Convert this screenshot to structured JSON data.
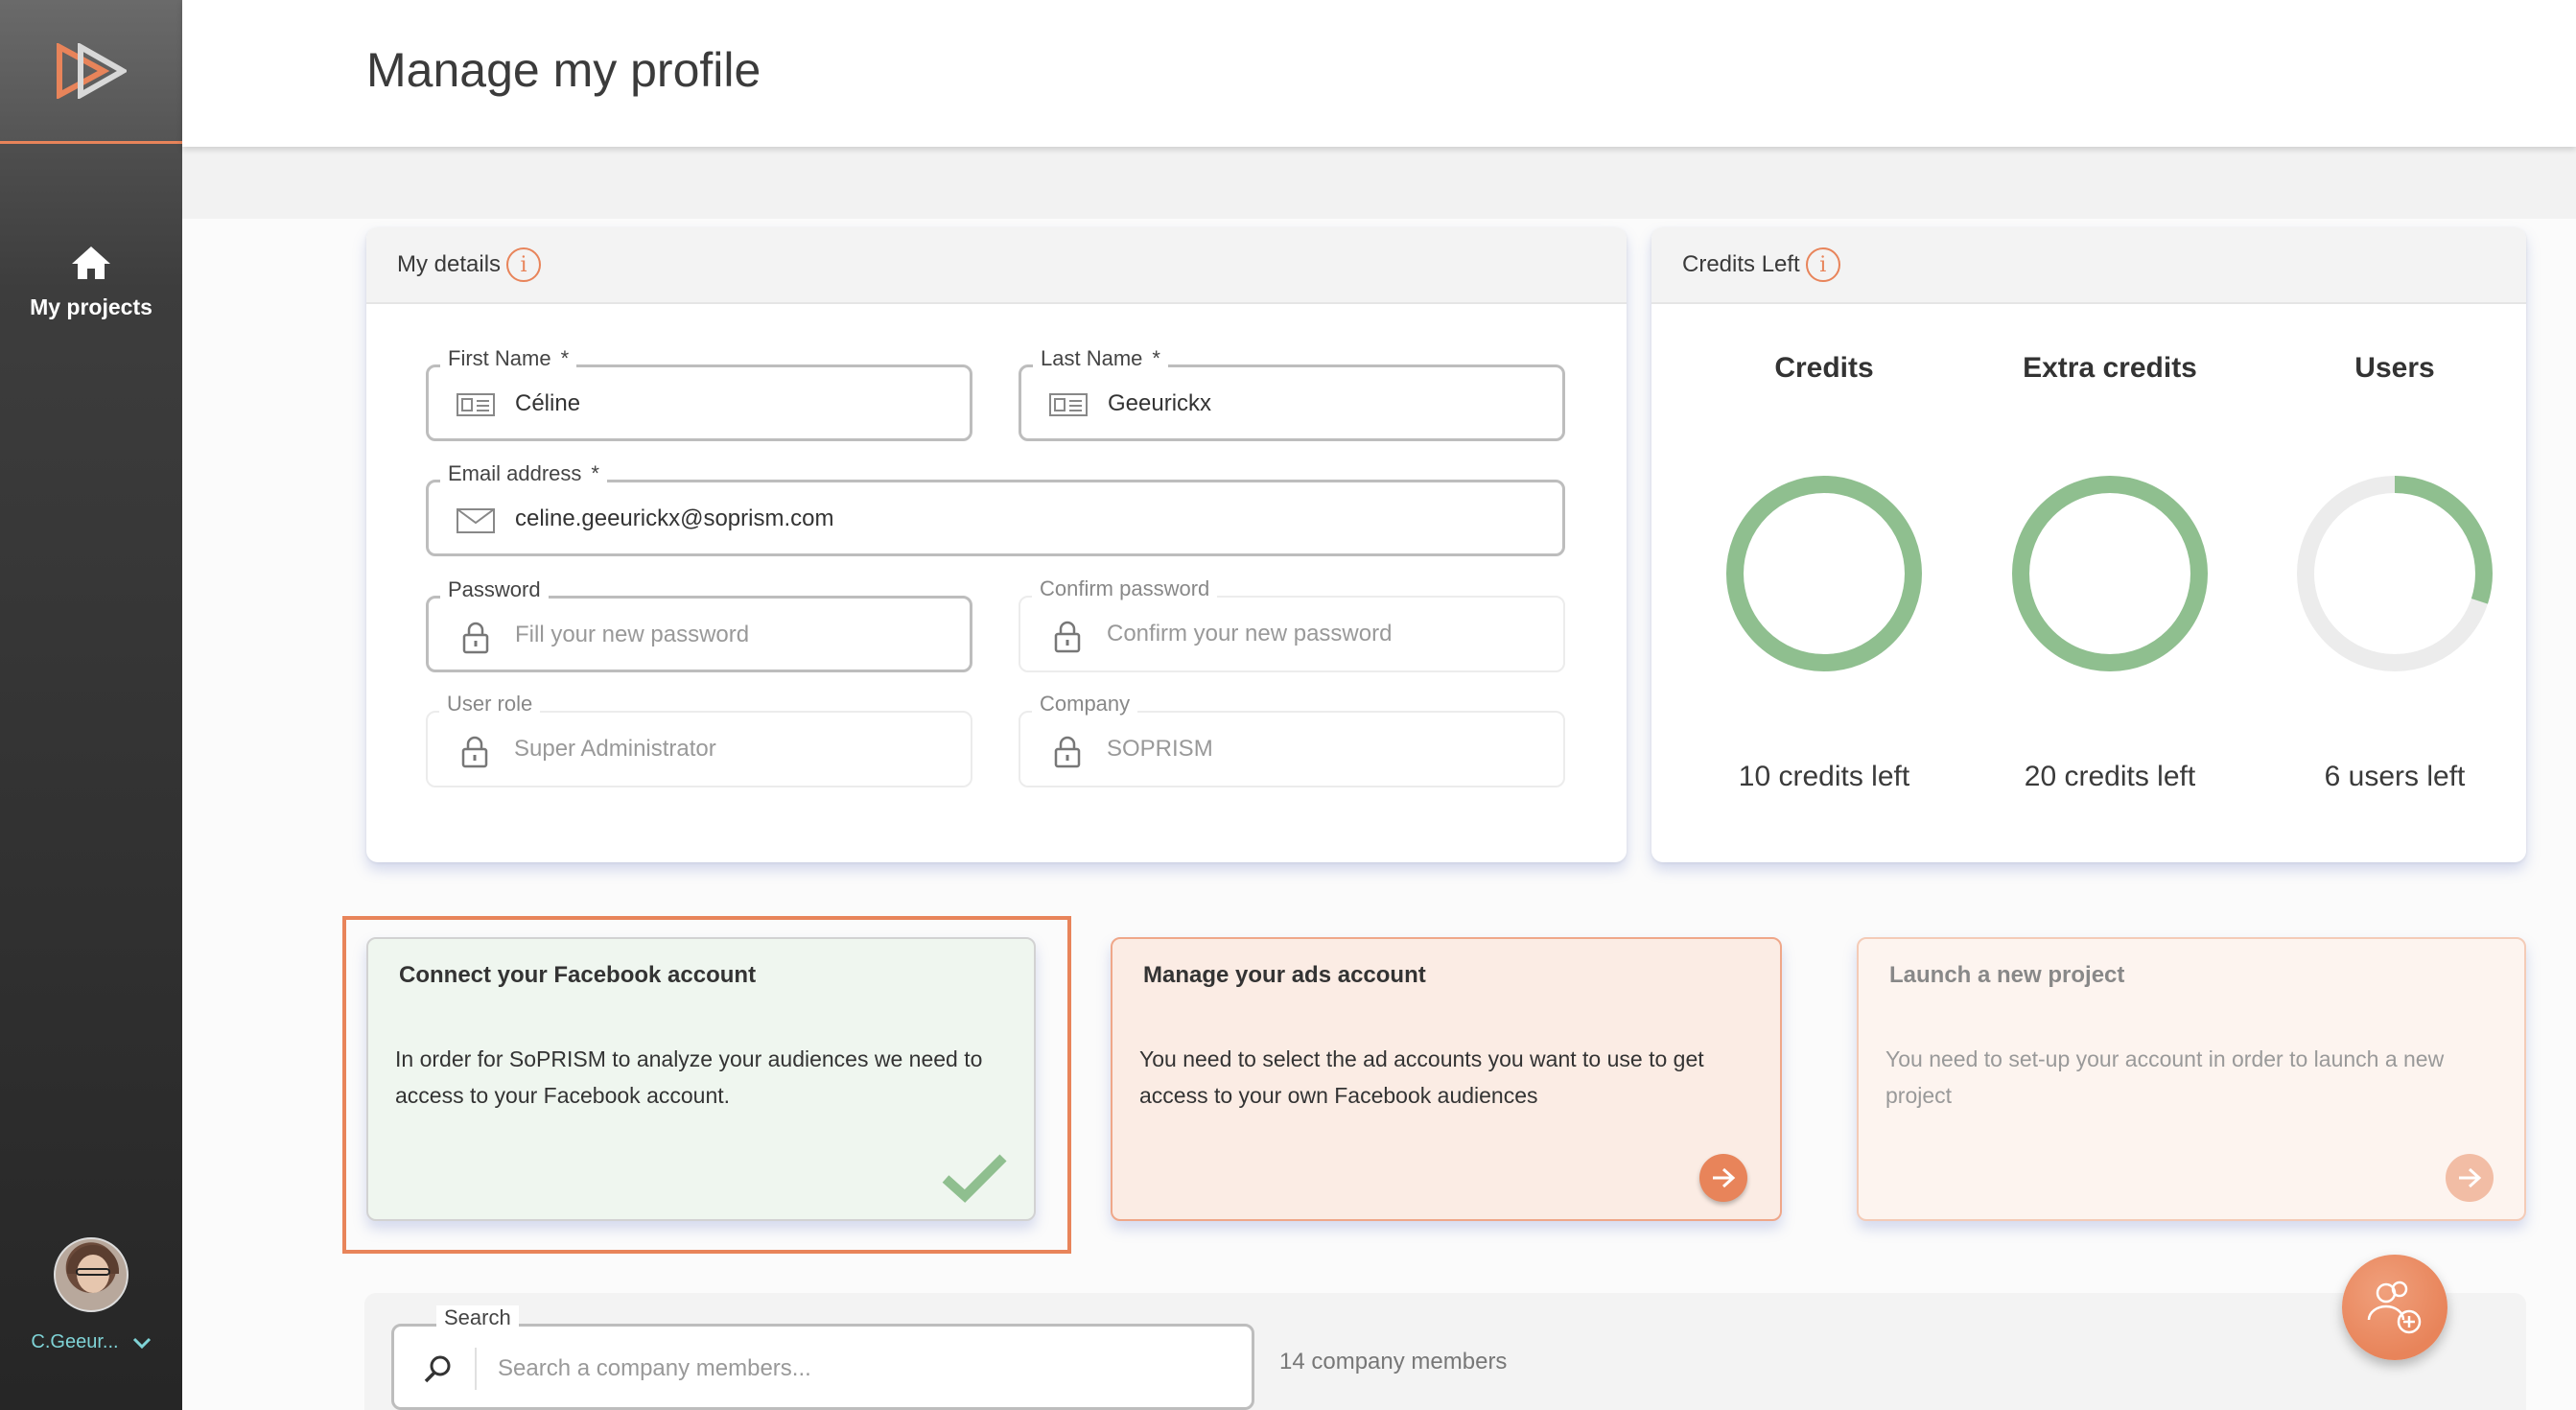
{
  "sidebar": {
    "nav": {
      "label": "My projects"
    },
    "user": {
      "name": "C.Geeur..."
    }
  },
  "header": {
    "title": "Manage my profile"
  },
  "details": {
    "title": "My details",
    "first_name": {
      "label": "First Name",
      "req": "*",
      "value": "Céline"
    },
    "last_name": {
      "label": "Last Name",
      "req": "*",
      "value": "Geeurickx"
    },
    "email": {
      "label": "Email address",
      "req": "*",
      "value": "celine.geeurickx@soprism.com"
    },
    "password": {
      "label": "Password",
      "placeholder": "Fill your new password"
    },
    "confirm_password": {
      "label": "Confirm password",
      "placeholder": "Confirm your new password"
    },
    "role": {
      "label": "User role",
      "value": "Super Administrator"
    },
    "company": {
      "label": "Company",
      "value": "SOPRISM"
    }
  },
  "credits": {
    "title": "Credits Left",
    "items": [
      {
        "title": "Credits",
        "sub": "10 credits left",
        "fraction": 1.0
      },
      {
        "title": "Extra credits",
        "sub": "20 credits left",
        "fraction": 1.0
      },
      {
        "title": "Users",
        "sub": "6 users left",
        "fraction": 0.3
      }
    ]
  },
  "actions": [
    {
      "title": "Connect your Facebook account",
      "text": "In order for SoPRISM to analyze your audiences we need to access to your Facebook account.",
      "status": "done"
    },
    {
      "title": "Manage your ads account",
      "text": "You need to select the ad accounts you want to use to get access to your own Facebook audiences",
      "status": "active"
    },
    {
      "title": "Launch a new project",
      "text": "You need to set-up your account in order to launch a new project",
      "status": "disabled"
    }
  ],
  "members": {
    "search_label": "Search",
    "search_placeholder": "Search a company members...",
    "count": "14 company members"
  },
  "colors": {
    "accent": "#e8845a",
    "ring": "#8fbf8f",
    "sidebar": "#2b2b2b"
  }
}
